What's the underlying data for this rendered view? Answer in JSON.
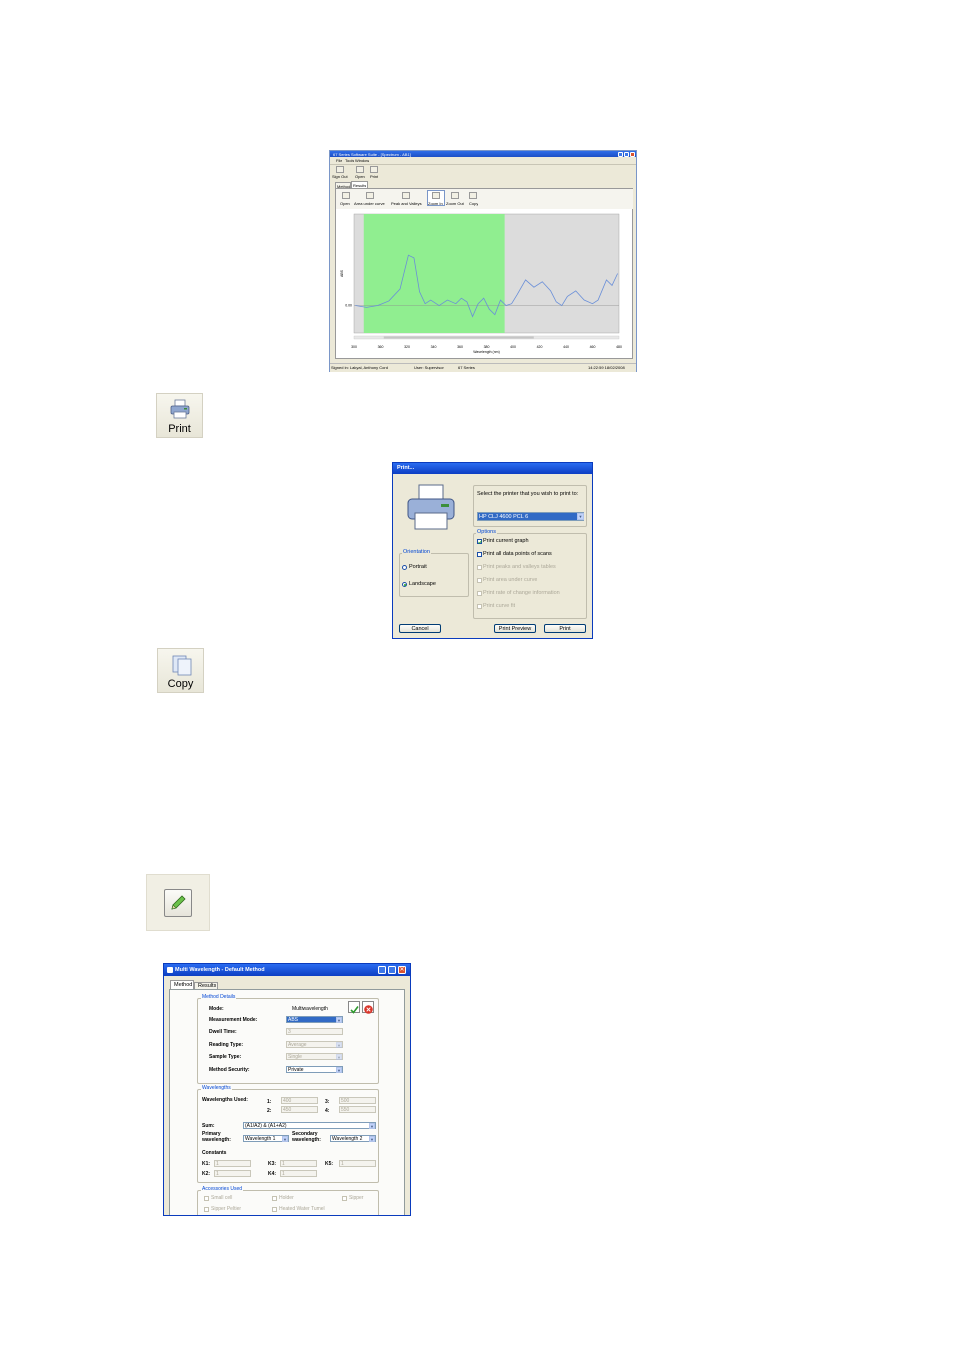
{
  "spectrum_window": {
    "title": "67 Series Software Suite - [Spectrum - AB1]",
    "menu": [
      "File",
      "Tools",
      "Window"
    ],
    "toolbar": [
      "Sign Out",
      "Open",
      "Print"
    ],
    "tabs": [
      "Method",
      "Results"
    ],
    "results_toolbar": [
      "Open",
      "Area under curve",
      "Peak and Valleys",
      "Zoom In",
      "Zoom Out",
      "Copy"
    ],
    "status": {
      "user": "Signed in: Lakyal, Anthony Cord",
      "role": "User: Supervisor",
      "model": "67 Series",
      "datetime": "14:22:59 18/02/2008"
    },
    "chart_data": {
      "type": "line",
      "ylabel": "ABS",
      "xlabel": "Wavelength (nm)",
      "x_ticks": [
        300,
        360,
        320,
        340,
        360,
        380,
        400,
        420,
        440,
        460,
        480
      ],
      "x_tick_labels": [
        "300",
        "360",
        "320",
        "340",
        "360",
        "380",
        "400",
        "420",
        "440",
        "460",
        "480"
      ],
      "y_tick_labels": [
        "0.00"
      ],
      "xlim": [
        295,
        485
      ],
      "highlight_range": [
        302,
        403
      ],
      "highlight_color": "#90ee90",
      "plot_bg": "#dcdcdc",
      "series_color": "#6a8fd8",
      "x": [
        296,
        304,
        312,
        320,
        328,
        334,
        338,
        342,
        346,
        350,
        356,
        362,
        368,
        372,
        376,
        380,
        384,
        388,
        392,
        396,
        400,
        404,
        408,
        412,
        418,
        424,
        430,
        436,
        440,
        444,
        448,
        454,
        460,
        466,
        470,
        476,
        480,
        484
      ],
      "y": [
        0.0,
        -0.02,
        0.0,
        0.05,
        0.18,
        0.55,
        0.52,
        0.15,
        0.02,
        0.06,
        0.0,
        0.06,
        0.02,
        0.08,
        0.04,
        -0.12,
        0.02,
        0.08,
        -0.04,
        -0.1,
        0.06,
        0.0,
        0.02,
        0.12,
        0.28,
        0.2,
        0.26,
        0.16,
        0.04,
        0.0,
        0.1,
        0.16,
        0.06,
        0.02,
        0.06,
        0.28,
        0.22,
        0.35
      ]
    }
  },
  "print_button": {
    "label": "Print"
  },
  "print_dialog": {
    "title": "Print...",
    "select_label": "Select the printer that you wish to print to:",
    "printer": "HP CLJ 4600 PCL 6",
    "orientation_label": "Orientation",
    "portrait": "Portrait",
    "landscape": "Landscape",
    "options_label": "Options",
    "options": [
      {
        "label": "Print current graph",
        "checked": true,
        "enabled": true
      },
      {
        "label": "Print all data points of scans",
        "checked": false,
        "enabled": true
      },
      {
        "label": "Print peaks and valleys tables",
        "checked": false,
        "enabled": false
      },
      {
        "label": "Print area under curve",
        "checked": false,
        "enabled": false
      },
      {
        "label": "Print rate of change information",
        "checked": false,
        "enabled": false
      },
      {
        "label": "Print curve fit",
        "checked": false,
        "enabled": false
      }
    ],
    "cancel": "Cancel",
    "preview": "Print Preview",
    "print": "Print"
  },
  "copy_button": {
    "label": "Copy"
  },
  "multi_window": {
    "title": "Multi Wavelength - Default Method",
    "tabs": [
      "Method",
      "Results"
    ],
    "method_details_label": "Method Details",
    "mode_label": "Mode:",
    "mode_value": "Multiwavelength",
    "measurement_mode_label": "Measurement Mode:",
    "measurement_mode_value": "ABS",
    "dwell_time_label": "Dwell Time:",
    "dwell_time_value": "3",
    "reading_type_label": "Reading Type:",
    "reading_type_value": "Average",
    "sample_type_label": "Sample Type:",
    "sample_type_value": "Single",
    "method_security_label": "Method Security:",
    "method_security_value": "Private",
    "wavelengths_label": "Wavelengths",
    "wavelengths_used_label": "Wavelengths Used:",
    "w1_label": "1:",
    "w1": "400",
    "w2_label": "2:",
    "w2": "450",
    "w3_label": "3:",
    "w3": "500",
    "w4_label": "4:",
    "w4": "550",
    "sum_label": "Sum:",
    "sum_value": "(A1/A2) & (A1+A2)",
    "primary_label": "Primary wavelength:",
    "primary_value": "Wavelength 1",
    "secondary_label": "Secondary wavelength:",
    "secondary_value": "Wavelength 2",
    "constants_label": "Constants",
    "k1_label": "K1:",
    "k1": "1",
    "k2_label": "K2:",
    "k2": "1",
    "k3_label": "K3:",
    "k3": "1",
    "k4_label": "K4:",
    "k4": "1",
    "k5_label": "K5:",
    "k5": "1",
    "accessories_label": "Accessories Used",
    "acc": [
      "Small cell",
      "Holder",
      "Sipper",
      "Sipper Peltier",
      "Heated Water Tumel"
    ]
  }
}
